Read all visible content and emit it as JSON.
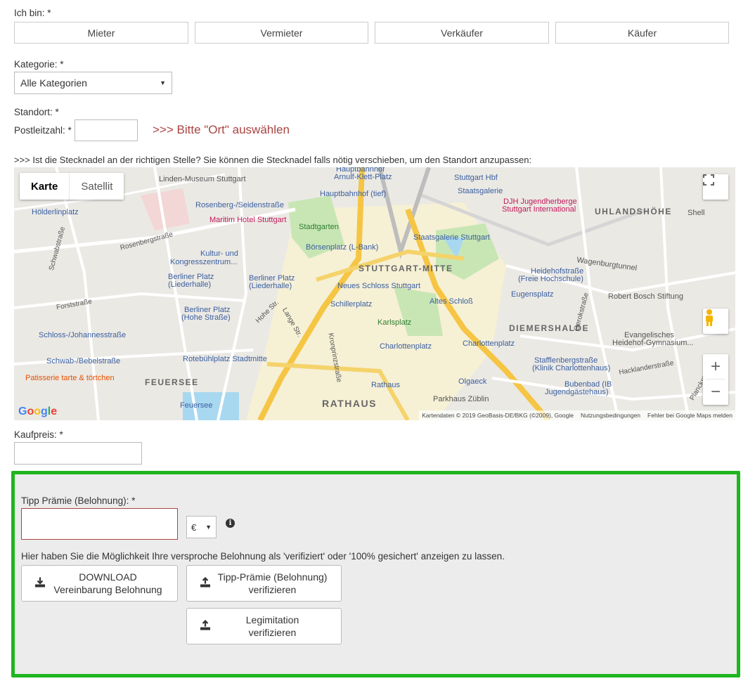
{
  "role": {
    "label": "Ich bin: *",
    "options": [
      "Mieter",
      "Vermieter",
      "Verkäufer",
      "Käufer"
    ]
  },
  "category": {
    "label": "Kategorie: *",
    "selected": "Alle Kategorien"
  },
  "location": {
    "label": "Standort: *",
    "zip_label": "Postleitzahl: *",
    "zip_value": "",
    "warning": ">>> Bitte \"Ort\" auswählen"
  },
  "map": {
    "hint": ">>> Ist die Stecknadel an der richtigen Stelle? Sie können die Stecknadel falls nötig verschieben, um den Standort anzupassen:",
    "type_map": "Karte",
    "type_satellite": "Satellit",
    "labels": [
      "Linden-Museum Stuttgart",
      "Hauptbahnhof",
      "Arnulf-Klett-Platz",
      "Stuttgart Hbf",
      "Hauptbahnhof (tief)",
      "Staatsgalerie",
      "DJH Jugendherberge",
      "Stuttgart International",
      "UHLANDSHÖHE",
      "Shell",
      "Hölderlinplatz",
      "Rosenberg-/Seidenstraße",
      "Maritim Hotel Stuttgart",
      "Stadtgarten",
      "Staatsgalerie Stuttgart",
      "Kultur- und",
      "Kongresszentrum...",
      "Börsenplatz (L-Bank)",
      "STUTTGART-MITTE",
      "Wagenburgtunnel",
      "Heidehofstraße",
      "(Freie Hochschule)",
      "Berliner Platz",
      "(Liederhalle)",
      "Neues Schloss Stuttgart",
      "Eugensplatz",
      "Robert Bosch Stiftung",
      "Schillerplatz",
      "Altes Schloß",
      "(Hohe Straße)",
      "Karlsplatz",
      "DIEMERSHALDE",
      "Evangelisches",
      "Heidehof-Gymnasium...",
      "Schloss-/Johannesstraße",
      "Charlottenplatz",
      "Rotebühlplatz Stadtmitte",
      "Stafflenbergstraße",
      "(Klinik Charlottenhaus)",
      "Schwab-/Bebelstraße",
      "Patisserie tarte & törtchen",
      "FEUERSEE",
      "Olgaeck",
      "Rathaus",
      "Bubenbad (IB",
      "Jugendgästehaus)",
      "Feuersee",
      "RATHAUS",
      "Parkhaus Züblin",
      "Rosenbergstraße",
      "Schwabstraße",
      "Forststraße",
      "Hohe Str.",
      "Lange Str.",
      "Kronprinzstraße",
      "Gerokstraße",
      "Hacklanderstraße",
      "Planckstraße"
    ],
    "footer": [
      "Kartendaten © 2019 GeoBasis-DE/BKG (©2009), Google",
      "Nutzungsbedingungen",
      "Fehler bei Google Maps melden"
    ],
    "logo": "Google"
  },
  "price": {
    "label": "Kaufpreis: *",
    "value": ""
  },
  "reward": {
    "label": "Tipp Prämie (Belohnung): *",
    "value": "",
    "currency": "€",
    "info_text": "Hier haben Sie die Möglichkeit Ihre versproche Belohnung als 'verifiziert' oder '100% gesichert' anzeigen zu lassen.",
    "btn_download_1": "DOWNLOAD",
    "btn_download_2": "Vereinbarung Belohnung",
    "btn_verify_1": "Tipp-Prämie (Belohnung)",
    "btn_verify_2": "verifizieren",
    "btn_legit_1": "Legimitation",
    "btn_legit_2": "verifizieren"
  },
  "colors": {
    "highlight_border": "#1fb51f",
    "warning": "#a94442",
    "error_border": "#a94442"
  }
}
